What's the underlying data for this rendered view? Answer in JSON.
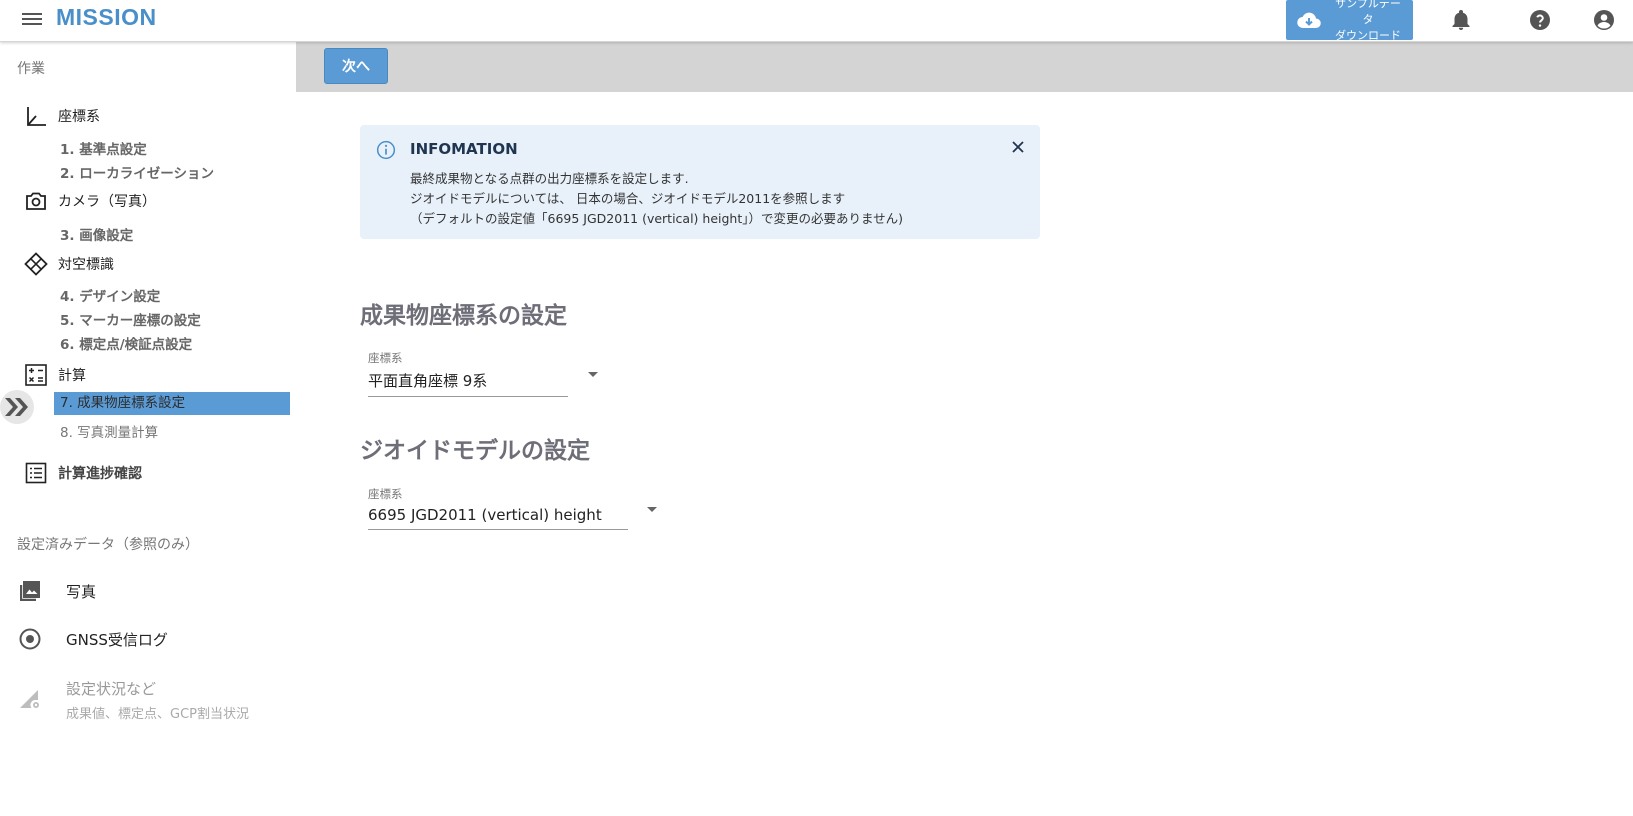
{
  "header": {
    "title": "MISSION",
    "sample_download": "サンプルデータ\nダウンロード",
    "sample_line1": "サンプルデータ",
    "sample_line2": "ダウンロード"
  },
  "sidebar": {
    "work_label": "作業",
    "categories": [
      {
        "label": "座標系",
        "icon": "axis-icon"
      },
      {
        "label": "カメラ（写真）",
        "icon": "camera-icon"
      },
      {
        "label": "対空標識",
        "icon": "marker-icon"
      },
      {
        "label": "計算",
        "icon": "calculator-icon"
      }
    ],
    "steps": [
      "1. 基準点設定",
      "2. ローカライゼーション",
      "3. 画像設定",
      "4. デザイン設定",
      "5. マーカー座標の設定",
      "6. 標定点/検証点設定",
      "7. 成果物座標系設定",
      "8. 写真測量計算"
    ],
    "progress_label": "計算進捗確認",
    "configured_label": "設定済みデータ（参照のみ）",
    "ref_items": [
      {
        "label": "写真"
      },
      {
        "label": "GNSS受信ログ"
      },
      {
        "label": "設定状況など",
        "sub": "成果値、標定点、GCP割当状況"
      }
    ]
  },
  "main": {
    "next_label": "次へ",
    "info": {
      "title": "INFOMATION",
      "lines": [
        "最終成果物となる点群の出力座標系を設定します.",
        "ジオイドモデルについては、 日本の場合、ジオイドモデル2011を参照します",
        "（デフォルトの設定値「6695 JGD2011 (vertical) height」）で変更の必要ありません)"
      ]
    },
    "section1": {
      "title": "成果物座標系の設定",
      "field_label": "座標系",
      "field_value": "平面直角座標 9系"
    },
    "section2": {
      "title": "ジオイドモデルの設定",
      "field_label": "座標系",
      "field_value": "6695 JGD2011 (vertical) height"
    }
  },
  "colors": {
    "accent": "#5b9bd5",
    "title": "#4a8fc9",
    "info_bg": "#e8f1fa",
    "topbar": "#d4d4d4"
  }
}
